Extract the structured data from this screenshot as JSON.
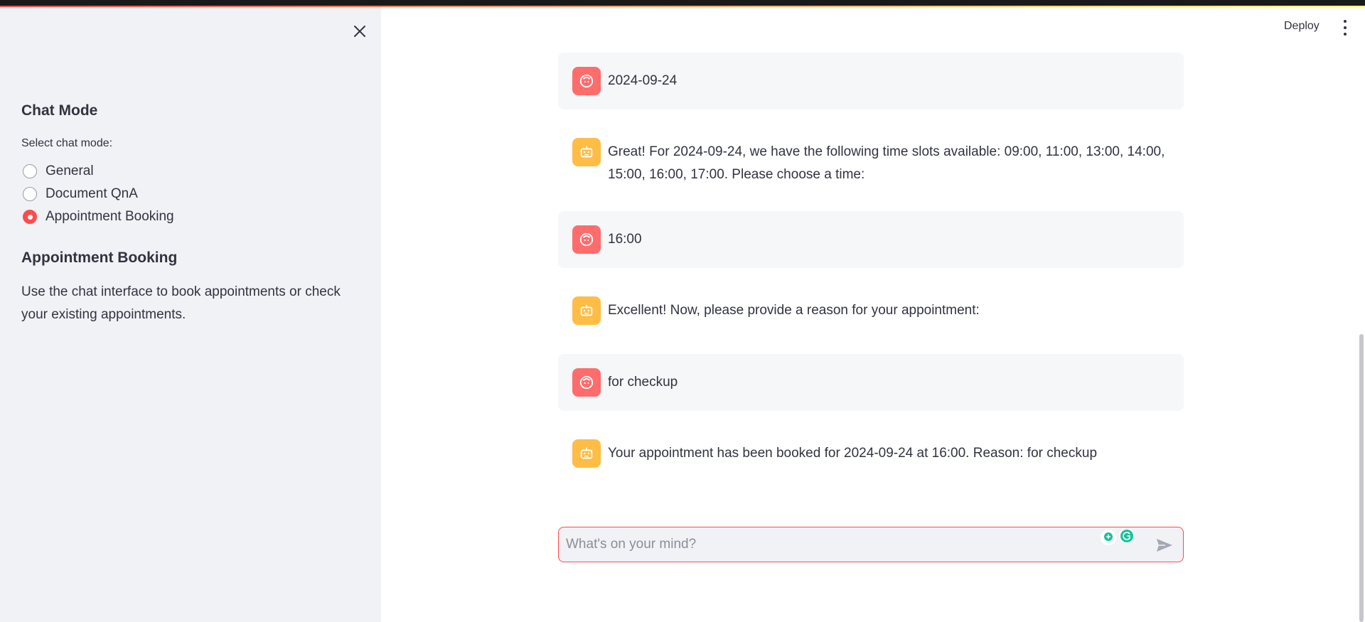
{
  "sidebar": {
    "close_icon": "close-icon",
    "chat_mode_heading": "Chat Mode",
    "select_label": "Select chat mode:",
    "options": [
      {
        "label": "General",
        "selected": false
      },
      {
        "label": "Document QnA",
        "selected": false
      },
      {
        "label": "Appointment Booking",
        "selected": true
      }
    ],
    "section_heading": "Appointment Booking",
    "description": "Use the chat interface to book appointments or check your existing appointments."
  },
  "header": {
    "deploy_label": "Deploy",
    "menu_icon": "kebab-menu-icon"
  },
  "messages": [
    {
      "role": "user",
      "icon": "user-face-icon",
      "text": "2024-09-24"
    },
    {
      "role": "assistant",
      "icon": "robot-icon",
      "text": "Great! For 2024-09-24, we have the following time slots available: 09:00, 11:00, 13:00, 14:00, 15:00, 16:00, 17:00. Please choose a time:"
    },
    {
      "role": "user",
      "icon": "user-face-icon",
      "text": "16:00"
    },
    {
      "role": "assistant",
      "icon": "robot-icon",
      "text": "Excellent! Now, please provide a reason for your appointment:"
    },
    {
      "role": "user",
      "icon": "user-face-icon",
      "text": "for checkup"
    },
    {
      "role": "assistant",
      "icon": "robot-icon",
      "text": "Your appointment has been booked for 2024-09-24 at 16:00. Reason: for checkup"
    }
  ],
  "chat_input": {
    "placeholder": "What's on your mind?",
    "value": "",
    "send_icon": "send-icon"
  },
  "colors": {
    "accent": "#ff4b4b",
    "user_avatar": "#ff6c6c",
    "bot_avatar": "#ffbd45",
    "sidebar_bg": "#f0f2f6"
  }
}
